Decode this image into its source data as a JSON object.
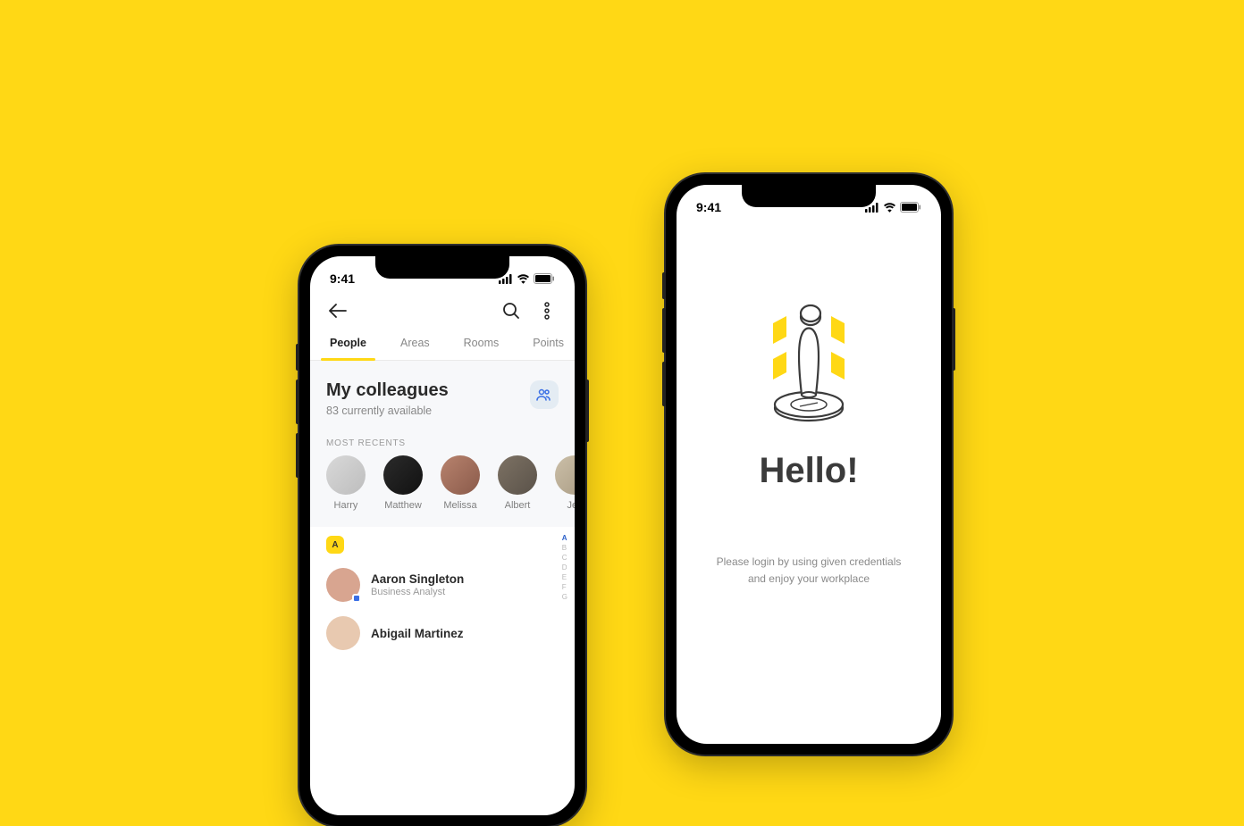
{
  "status": {
    "time": "9:41"
  },
  "left": {
    "tabs": [
      "People",
      "Areas",
      "Rooms",
      "Points"
    ],
    "section_title": "My colleagues",
    "section_sub": "83 currently available",
    "recents_label": "MOST RECENTS",
    "recents": [
      "Harry",
      "Matthew",
      "Melissa",
      "Albert",
      "Jes"
    ],
    "letter": "A",
    "contacts": [
      {
        "name": "Aaron Singleton",
        "role": "Business Analyst"
      },
      {
        "name": "Abigail Martinez",
        "role": ""
      }
    ],
    "index": [
      "A",
      "B",
      "C",
      "D",
      "E",
      "F",
      "G"
    ]
  },
  "right": {
    "title": "Hello!",
    "subtitle1": "Please login by using given credentials",
    "subtitle2": "and enjoy your workplace"
  }
}
